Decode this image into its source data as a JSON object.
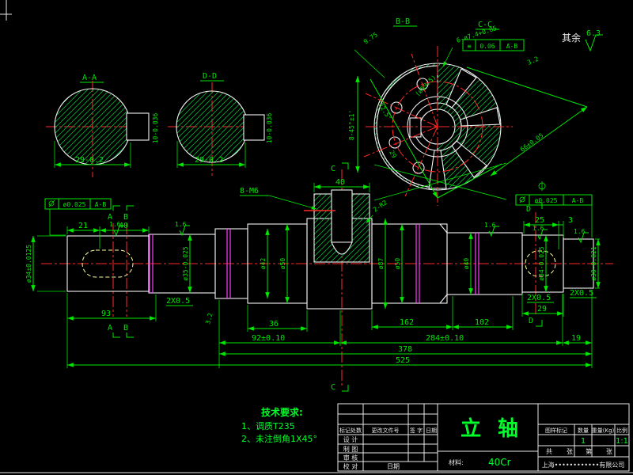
{
  "canvas": {
    "bg": "#000000"
  },
  "colors": {
    "outline": "#f2f2f2",
    "dimension": "#00e800",
    "centerline": "#ff2a2a",
    "groove": "#ff3cff",
    "keyway": "#ffff9c"
  },
  "sections": {
    "aa": {
      "label": "A-A",
      "width": "29-0.2",
      "key": "10-0.036"
    },
    "dd": {
      "label": "D-D",
      "width": "29-0.2",
      "key": "10-0.036"
    },
    "bb": {
      "label": "B-B"
    },
    "cc": {
      "label": "C-C"
    }
  },
  "flange": {
    "holes": "6-ø7.4+0.05",
    "radial": "9.75",
    "angle": "22.5°",
    "chamfers": "8-45°±1'",
    "bolt_circle": "(ø59.5)",
    "span": "66±0.05",
    "slant": "29",
    "finish": "3.2",
    "fcf": {
      "sym": "≡",
      "tol": "0.06",
      "datum": "A-B"
    }
  },
  "note": {
    "label": "其余",
    "value": "6.3"
  },
  "shaft": {
    "fcf_left": {
      "tol": "ø0.025",
      "datum": "A-B"
    },
    "fcf_right": {
      "tol": "ø0.025",
      "datum": "A-B"
    },
    "thread": "8-M6",
    "fillet": "2-R2",
    "chamfer": "2X0.5",
    "finish16": "1.6",
    "finish32": "3.2",
    "cut_a": "A",
    "cut_b": "B",
    "cut_c": "C",
    "cut_d": "D",
    "dims": {
      "d21": "21",
      "d40key": "40",
      "d93": "93",
      "d40top": "40",
      "d36": "36",
      "d162": "162",
      "d102": "102",
      "d92": "92±0.10",
      "d284": "284±0.10",
      "d19": "19",
      "d378": "378",
      "d525": "525",
      "d25": "25",
      "d3": "3",
      "d29": "29",
      "dia34": "ø34±0.0125",
      "dia35": "ø35-0.025",
      "dia42": "ø42",
      "dia50": "ø50",
      "dia87": "ø87",
      "dia50b": "ø50",
      "dia40": "ø40",
      "dia34b": "ø34-0.025",
      "dia30": "ø30-0.021"
    }
  },
  "tech": {
    "title": "技术要求:",
    "line1": "1、调质T235",
    "line2": "2、未注倒角1X45°"
  },
  "titleblock": {
    "title": "立 轴",
    "material_label": "材料:",
    "material": "40Cr",
    "col_mark": "标记处数",
    "col_doc": "更改文件号",
    "col_sign": "签 字",
    "col_date": "日期",
    "row_design": "设 计",
    "row_draft": "制 图",
    "row_check": "审 核",
    "row_proof": "校 对",
    "row_date": "日期",
    "h_mark": "图样标记",
    "h_qty": "数量",
    "h_weight": "重量(Kg)",
    "h_scale": "比例",
    "v_qty": "1",
    "v_scale": "1:1",
    "t_total": "共",
    "t_sheet": "张",
    "t_no": "第",
    "t_sheet2": "张",
    "company": "上海••••••••••••有限公司"
  }
}
